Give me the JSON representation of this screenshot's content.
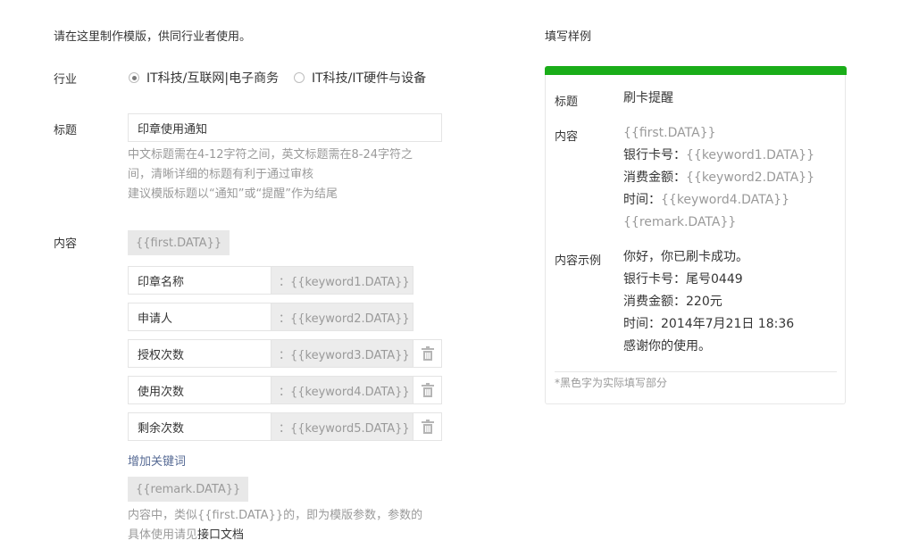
{
  "intro": "请在这里制作模版，供同行业者使用。",
  "industry": {
    "label": "行业",
    "options": [
      {
        "text": "IT科技/互联网|电子商务",
        "checked": true
      },
      {
        "text": "IT科技/IT硬件与设备",
        "checked": false
      }
    ]
  },
  "title_field": {
    "label": "标题",
    "value": "印章使用通知",
    "hint_line1": "中文标题需在4-12字符之间，英文标题需在8-24字符之",
    "hint_line2": "间，清晰详细的标题有利于通过审核",
    "hint_line3": "建议模版标题以“通知”或“提醒”作为结尾"
  },
  "content_field": {
    "label": "内容",
    "first_tag": "{{first.DATA}}",
    "keywords": [
      {
        "name": "印章名称",
        "data": "：{{keyword1.DATA}}",
        "deletable": false
      },
      {
        "name": "申请人",
        "data": "：{{keyword2.DATA}}",
        "deletable": false
      },
      {
        "name": "授权次数",
        "data": "：{{keyword3.DATA}}",
        "deletable": true
      },
      {
        "name": "使用次数",
        "data": "：{{keyword4.DATA}}",
        "deletable": true
      },
      {
        "name": "剩余次数",
        "data": "：{{keyword5.DATA}}",
        "deletable": true
      }
    ],
    "add_keyword": "增加关键词",
    "remark_tag": "{{remark.DATA}}",
    "note_line1": "内容中，类似{{first.DATA}}的，即为模版参数，参数的",
    "note_line2_prefix": "具体使用请见",
    "note_link": "接口文档"
  },
  "sample": {
    "heading": "填写样例",
    "accent_color": "#1aad19",
    "title_label": "标题",
    "title_value": "刷卡提醒",
    "content_label": "内容",
    "content_lines": [
      {
        "prefix": "",
        "param": "{{first.DATA}}"
      },
      {
        "prefix": "银行卡号：",
        "param": "{{keyword1.DATA}}"
      },
      {
        "prefix": "消费金额：",
        "param": "{{keyword2.DATA}}"
      },
      {
        "prefix": "时间：",
        "param": "{{keyword4.DATA}}"
      },
      {
        "prefix": "",
        "param": "{{remark.DATA}}"
      }
    ],
    "example_label": "内容示例",
    "example_lines": [
      "你好，你已刷卡成功。",
      "银行卡号：尾号0449",
      "消费金额：220元",
      "时间：2014年7月21日 18:36",
      "感谢你的使用。"
    ],
    "footnote": "*黑色字为实际填写部分"
  }
}
